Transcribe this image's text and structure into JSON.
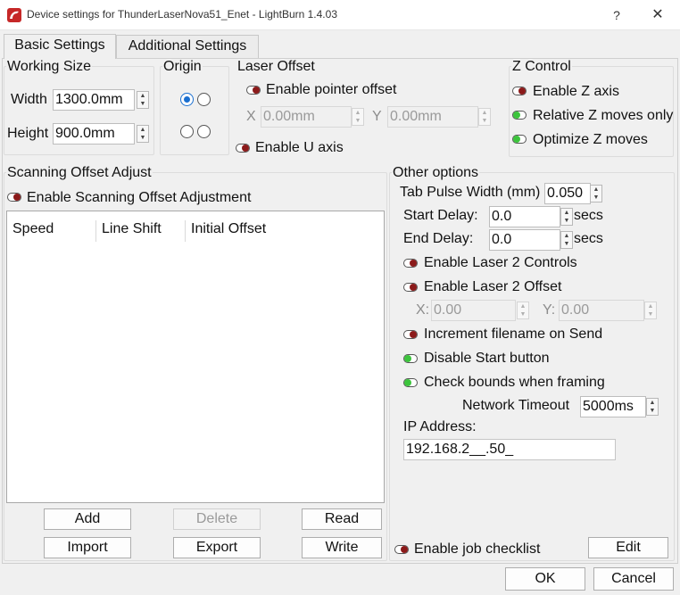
{
  "window": {
    "title": "Device settings for ThunderLaserNova51_Enet - LightBurn 1.4.03",
    "help": "?",
    "close": "✕"
  },
  "tabs": [
    "Basic Settings",
    "Additional Settings"
  ],
  "working_size": {
    "title": "Working Size",
    "width_label": "Width",
    "width_value": "1300.0mm",
    "height_label": "Height",
    "height_value": "900.0mm"
  },
  "origin": {
    "title": "Origin",
    "selected": "top-left"
  },
  "laser_offset": {
    "title": "Laser Offset",
    "enable_pointer": "Enable pointer offset",
    "x_label": "X",
    "x_value": "0.00mm",
    "y_label": "Y",
    "y_value": "0.00mm",
    "enable_u": "Enable U axis"
  },
  "z_control": {
    "title": "Z Control",
    "enable_z": "Enable Z axis",
    "relative_z": "Relative Z moves only",
    "optimize_z": "Optimize Z moves"
  },
  "scanning": {
    "title": "Scanning Offset Adjust",
    "enable": "Enable Scanning Offset Adjustment",
    "columns": [
      "Speed",
      "Line Shift",
      "Initial Offset"
    ],
    "buttons": {
      "add": "Add",
      "delete": "Delete",
      "read": "Read",
      "import": "Import",
      "export": "Export",
      "write": "Write"
    }
  },
  "other": {
    "title": "Other options",
    "tab_pulse_label": "Tab Pulse Width (mm)",
    "tab_pulse_value": "0.050",
    "start_delay_label": "Start Delay:",
    "start_delay_value": "0.0",
    "end_delay_label": "End Delay:",
    "end_delay_value": "0.0",
    "secs": "secs",
    "laser2_controls": "Enable Laser 2 Controls",
    "laser2_offset": "Enable Laser 2 Offset",
    "x_label": "X:",
    "x_value": "0.00",
    "y_label": "Y:",
    "y_value": "0.00",
    "increment_filename": "Increment filename on Send",
    "disable_start": "Disable Start button",
    "check_bounds": "Check bounds when framing",
    "network_timeout_label": "Network Timeout",
    "network_timeout_value": "5000ms",
    "ip_label": "IP Address:",
    "ip_value": "192.168.2__.50_",
    "job_checklist": "Enable job checklist",
    "edit": "Edit"
  },
  "footer": {
    "ok": "OK",
    "cancel": "Cancel"
  },
  "colors": {
    "toggle_off": "#8b1a1a",
    "toggle_on": "#3cc43c",
    "radio_selected": "#1a6fd0"
  }
}
